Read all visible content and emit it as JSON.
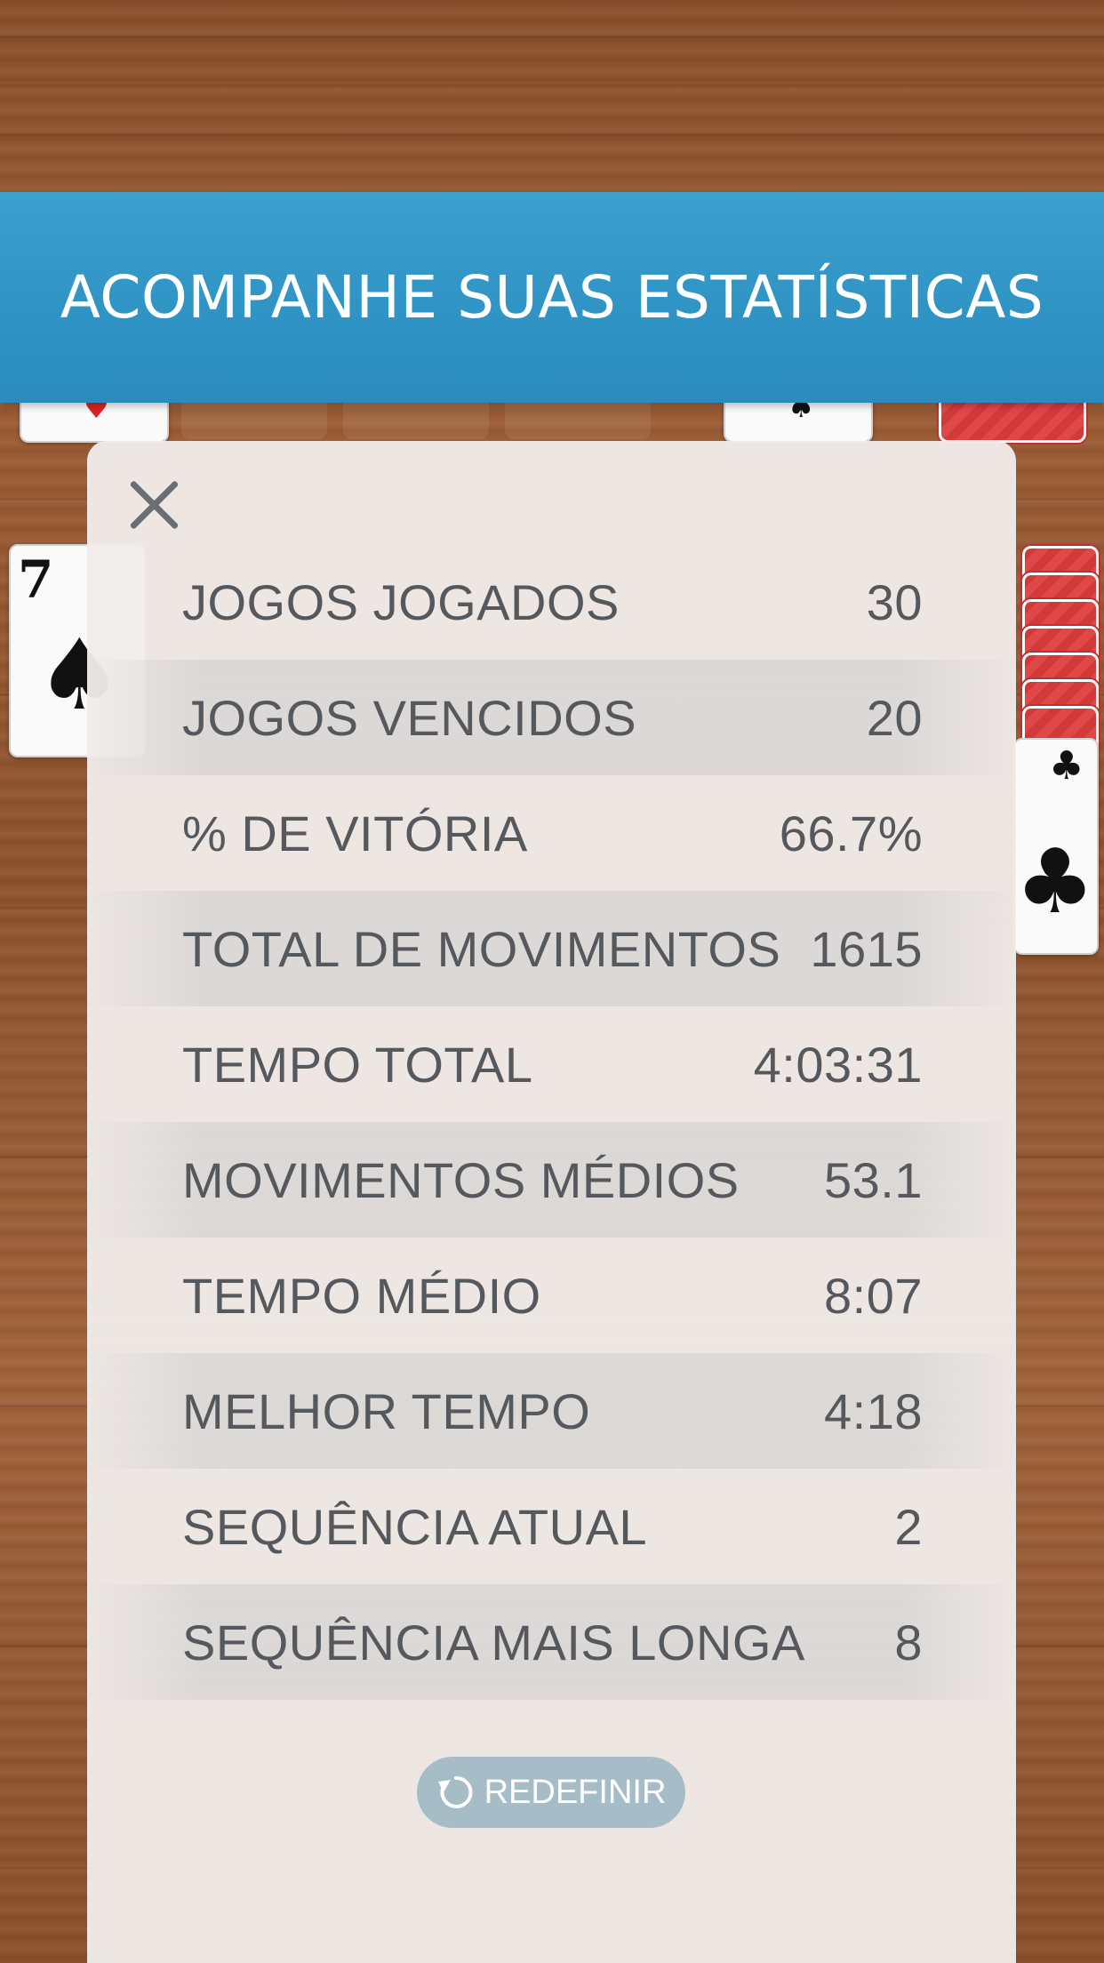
{
  "banner": {
    "title": "ACOMPANHE SUAS ESTATÍSTICAS"
  },
  "background_cards": {
    "left_rank": "7",
    "left_suit": "♠",
    "right_suit": "♣"
  },
  "modal": {
    "close_icon": "close-icon",
    "stats": [
      {
        "label": "JOGOS JOGADOS",
        "value": "30"
      },
      {
        "label": "JOGOS VENCIDOS",
        "value": "20"
      },
      {
        "label": "% DE VITÓRIA",
        "value": "66.7%"
      },
      {
        "label": "TOTAL DE MOVIMENTOS",
        "value": "1615"
      },
      {
        "label": "TEMPO TOTAL",
        "value": "4:03:31"
      },
      {
        "label": "MOVIMENTOS MÉDIOS",
        "value": "53.1"
      },
      {
        "label": "TEMPO MÉDIO",
        "value": "8:07"
      },
      {
        "label": "MELHOR TEMPO",
        "value": "4:18"
      },
      {
        "label": "SEQUÊNCIA ATUAL",
        "value": "2"
      },
      {
        "label": "SEQUÊNCIA MAIS LONGA",
        "value": "8"
      }
    ],
    "reset_label": "REDEFINIR",
    "reset_icon": "reset-icon"
  },
  "colors": {
    "banner": "#2f93c4",
    "text": "#55585d",
    "reset_button": "#a6bcc6"
  }
}
